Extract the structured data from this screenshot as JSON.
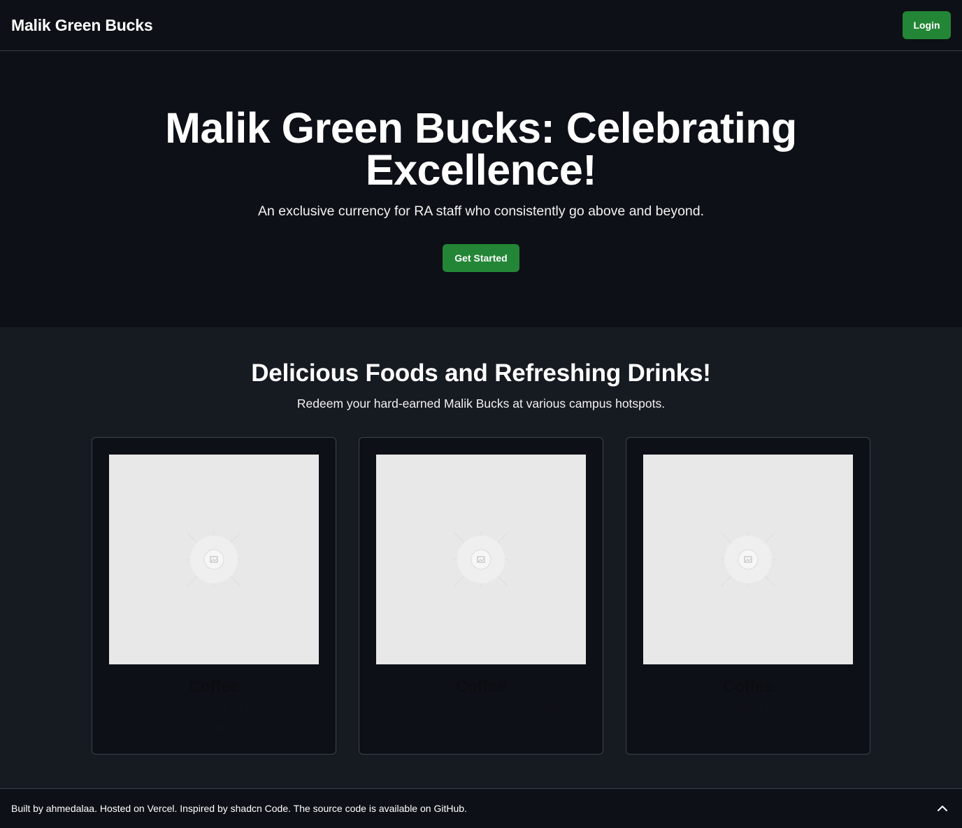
{
  "header": {
    "brand": "Malik Green Bucks",
    "login_label": "Login"
  },
  "hero": {
    "title": "Malik Green Bucks: Celebrating Excellence!",
    "subtitle": "An exclusive currency for RA staff who consistently go above and beyond.",
    "cta_label": "Get Started"
  },
  "section": {
    "title": "Delicious Foods and Refreshing Drinks!",
    "subtitle": "Redeem your hard-earned Malik Bucks at various campus hotspots."
  },
  "cards": [
    {
      "title": "Coffee",
      "description": "Get your caffeine fix from our partnered coffee shops.",
      "image_icon": "image-placeholder-icon"
    },
    {
      "title": "Coffee",
      "description": "Get your caffeine fix from our partnered coffee shops.",
      "image_icon": "image-placeholder-icon"
    },
    {
      "title": "Coffee",
      "description": "Get your caffeine fix from our partnered coffee shops.",
      "image_icon": "image-placeholder-icon"
    }
  ],
  "footer": {
    "text": "Built by ahmedalaa. Hosted on Vercel. Inspired by shadcn Code. The source code is available on GitHub.",
    "scroll_icon": "chevron-up-icon"
  },
  "colors": {
    "accent": "#238636",
    "header_bg": "#0d1016",
    "page_bg": "#161a21",
    "card_border": "#3d434b"
  }
}
